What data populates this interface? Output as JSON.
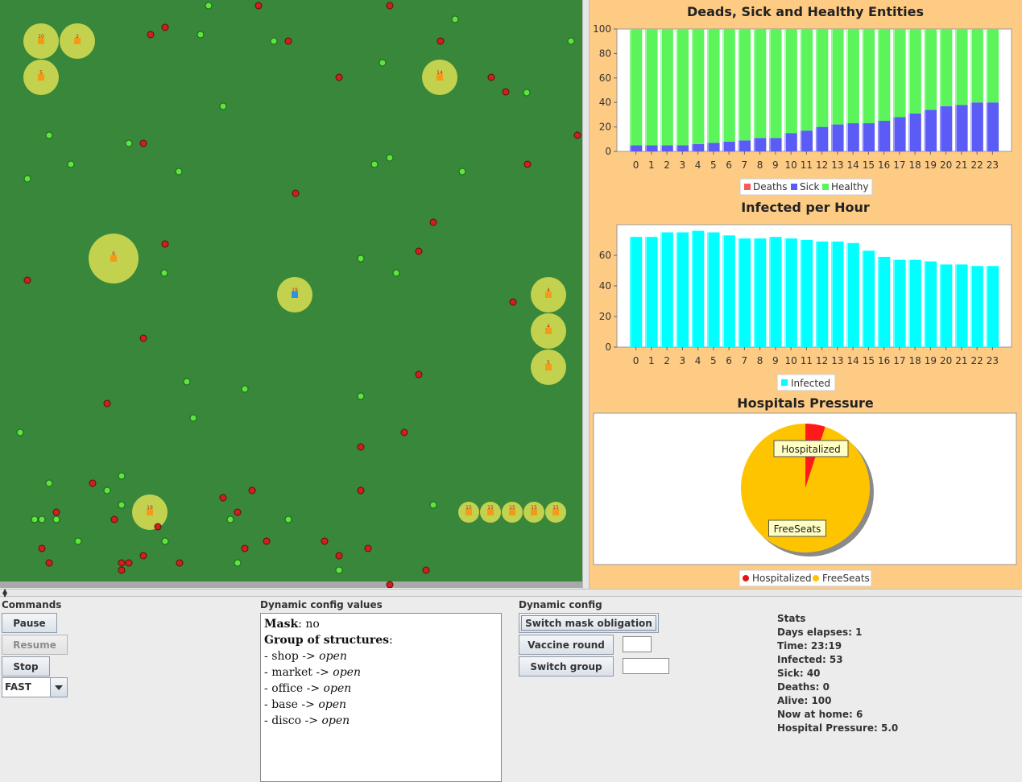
{
  "simulation": {
    "structures": [
      {
        "label": "10",
        "x": 51,
        "y": 51,
        "r": 22
      },
      {
        "label": "2",
        "x": 96,
        "y": 51,
        "r": 22
      },
      {
        "label": "5",
        "x": 51,
        "y": 96,
        "r": 22
      },
      {
        "label": "14",
        "x": 546,
        "y": 96,
        "r": 22
      },
      {
        "label": "9",
        "x": 141,
        "y": 321,
        "r": 31
      },
      {
        "label": "19",
        "x": 366,
        "y": 366,
        "r": 22,
        "highlight": true
      },
      {
        "label": "4",
        "x": 681,
        "y": 366,
        "r": 22
      },
      {
        "label": "4",
        "x": 681,
        "y": 411,
        "r": 22
      },
      {
        "label": "5",
        "x": 681,
        "y": 456,
        "r": 22
      },
      {
        "label": "19",
        "x": 186,
        "y": 636,
        "r": 22
      },
      {
        "label": "15",
        "x": 582,
        "y": 636,
        "r": 13
      },
      {
        "label": "15",
        "x": 609,
        "y": 636,
        "r": 13
      },
      {
        "label": "15",
        "x": 636,
        "y": 636,
        "r": 13
      },
      {
        "label": "15",
        "x": 663,
        "y": 636,
        "r": 13
      },
      {
        "label": "15",
        "x": 690,
        "y": 636,
        "r": 13
      }
    ]
  },
  "charts": {
    "bar_chart": {
      "title": "Deads, Sick and Healthy Entities",
      "legend": [
        "Deaths",
        "Sick",
        "Healthy"
      ]
    },
    "infected_chart": {
      "title": "Infected per Hour",
      "legend": [
        "Infected"
      ]
    },
    "pie_chart": {
      "title": "Hospitals Pressure",
      "label_hospitalized": "Hospitalized",
      "label_freeseats": "FreeSeats",
      "legend": [
        "Hospitalized",
        "FreeSeats"
      ]
    }
  },
  "chart_data": [
    {
      "type": "bar",
      "title": "Deads, Sick and Healthy Entities",
      "categories": [
        "0",
        "1",
        "2",
        "3",
        "4",
        "5",
        "6",
        "7",
        "8",
        "9",
        "10",
        "11",
        "12",
        "13",
        "14",
        "15",
        "16",
        "17",
        "18",
        "19",
        "20",
        "21",
        "22",
        "23"
      ],
      "ylim": [
        0,
        100
      ],
      "yticks": [
        0,
        20,
        40,
        60,
        80,
        100
      ],
      "stacked": true,
      "series": [
        {
          "name": "Deaths",
          "color": "#f55b5b",
          "values": [
            0,
            0,
            0,
            0,
            0,
            0,
            0,
            0,
            0,
            0,
            0,
            0,
            0,
            0,
            0,
            0,
            0,
            0,
            0,
            0,
            0,
            0,
            0,
            0
          ]
        },
        {
          "name": "Sick",
          "color": "#5b5bf5",
          "values": [
            5,
            5,
            5,
            5,
            6,
            7,
            8,
            9,
            11,
            11,
            15,
            17,
            20,
            22,
            23,
            23,
            25,
            28,
            31,
            34,
            37,
            38,
            40,
            40
          ]
        },
        {
          "name": "Healthy",
          "color": "#5bf55b",
          "values": [
            95,
            95,
            95,
            95,
            94,
            93,
            92,
            91,
            89,
            89,
            85,
            83,
            80,
            78,
            77,
            77,
            75,
            72,
            69,
            66,
            63,
            62,
            60,
            60
          ]
        }
      ],
      "legend_position": "bottom"
    },
    {
      "type": "bar",
      "title": "Infected per Hour",
      "categories": [
        "0",
        "1",
        "2",
        "3",
        "4",
        "5",
        "6",
        "7",
        "8",
        "9",
        "10",
        "11",
        "12",
        "13",
        "14",
        "15",
        "16",
        "17",
        "18",
        "19",
        "20",
        "21",
        "22",
        "23"
      ],
      "ylim": [
        0,
        80
      ],
      "yticks": [
        0,
        20,
        40,
        60
      ],
      "series": [
        {
          "name": "Infected",
          "color": "#00ffff",
          "values": [
            72,
            72,
            75,
            75,
            76,
            75,
            73,
            71,
            71,
            72,
            71,
            70,
            69,
            69,
            68,
            63,
            59,
            57,
            57,
            56,
            54,
            54,
            53,
            53
          ]
        }
      ],
      "legend_position": "bottom"
    },
    {
      "type": "pie",
      "title": "Hospitals Pressure",
      "categories": [
        "Hospitalized",
        "FreeSeats"
      ],
      "values": [
        5.0,
        95.0
      ],
      "colors": [
        "#ff1a1a",
        "#ffc400"
      ],
      "legend_position": "bottom"
    }
  ],
  "commands": {
    "title": "Commands",
    "pause": "Pause",
    "resume": "Resume",
    "stop": "Stop",
    "speed": "FAST"
  },
  "dynamic_values": {
    "title": "Dynamic config values",
    "mask_label": "Mask",
    "mask_value": "no",
    "group_label": "Group of structures",
    "items": [
      {
        "name": "shop",
        "state": "open"
      },
      {
        "name": "market",
        "state": "open"
      },
      {
        "name": "office",
        "state": "open"
      },
      {
        "name": "base",
        "state": "open"
      },
      {
        "name": "disco",
        "state": "open"
      }
    ]
  },
  "dynamic_config": {
    "title": "Dynamic config",
    "switch_mask": "Switch mask obligation",
    "vaccine_round": "Vaccine round",
    "switch_group": "Switch group",
    "vaccine_value": "",
    "group_value": ""
  },
  "stats": {
    "title": "Stats",
    "lines": [
      "Days elapses: 1",
      "Time: 23:19",
      "Infected: 53",
      "Sick: 40",
      "Deaths: 0",
      "Alive: 100",
      "Now at home: 6",
      "Hospital Pressure:  5.0"
    ]
  }
}
